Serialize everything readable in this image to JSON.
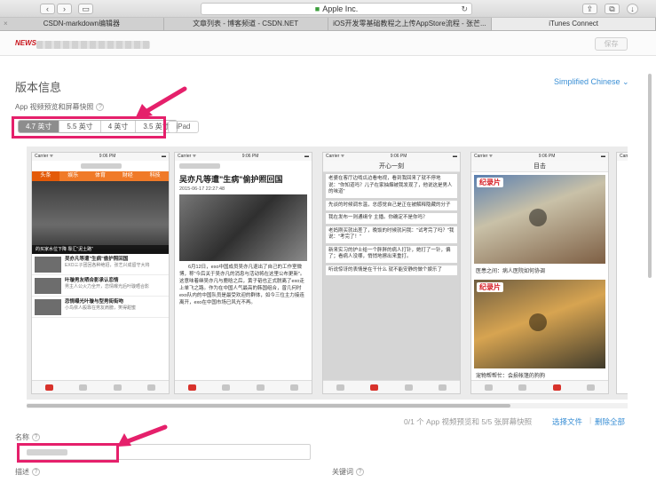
{
  "browser": {
    "address": "Apple Inc.",
    "tabs": [
      {
        "label": "CSDN-markdown编辑器",
        "active": false
      },
      {
        "label": "文章列表 - 博客频道 - CSDN.NET",
        "active": false
      },
      {
        "label": "iOS开发零基础教程之上传AppStore流程 - 张芒...",
        "active": false
      },
      {
        "label": "iTunes Connect",
        "active": true
      }
    ]
  },
  "header": {
    "logo_text": "NEWS",
    "save_label": "保存"
  },
  "main": {
    "section_title": "版本信息",
    "language": "Simplified Chinese ⌄",
    "media_label": "App 视频预览和屏幕快照",
    "help_mark": "?",
    "device_tabs": [
      {
        "label": "4.7 英寸",
        "active": true
      },
      {
        "label": "5.5 英寸",
        "active": false
      },
      {
        "label": "4 英寸",
        "active": false
      },
      {
        "label": "3.5 英寸",
        "active": false
      }
    ],
    "ipad_label": "iPad",
    "screenshot_meta": "0/1 个 App 视频预览和 5/5 张屏幕快照",
    "choose_file": "选择文件",
    "delete_all": "删除全部",
    "separator": "|",
    "name_label": "名称",
    "desc_label": "描述",
    "keywords_label": "关键词"
  },
  "screens": {
    "carrier": "Carrier ᯤ",
    "time": "9:06 PM",
    "s1": {
      "nav": [
        "头条",
        "娱乐",
        "体育",
        "财经",
        "科技"
      ],
      "hero_caption": "的买家水位下降 靠汇\"泥土路\"",
      "hero_headline": "吴亦凡等遭\"生病\"偷护照回国",
      "items": [
        {
          "title": "吴亦凡等遭\"生病\"偷护照回国",
          "sub": "EXO三子团回各种绝招，张艺兴成留守大将"
        },
        {
          "title": "叶璇男友晒合影承认恋情",
          "sub": "男主人公火力全开，恋情曝光后叶璇晒合影"
        },
        {
          "title": "恋情曝光叶璇与型男街街吻",
          "sub": "小鸟依人般靠在男友肩膀，笑得甜蜜"
        }
      ]
    },
    "s2": {
      "title": "吴亦凡等遭\"生病\"偷护照回国",
      "date": "2015-06-17 22:27:48",
      "body": "6月12日，exo中国成员吴亦凡退出了自己的工作室微博，称\"今后关于吴亦凡的消息与活动将在这里公布更新\"。这意味着继吴亦凡与鹿晗之后，黄子韬也正式脱离了exo走上单飞之路。作为在中国人气最高的韩国组合，曾几何时exo队内的中国队员是最受欢迎的群体，如今三位主力接连离开，exo在中国市场已风光不再。"
    },
    "s3": {
      "title": "开心一刻",
      "cards": [
        "老婆在客厅边啃瓜边看电视，看到我回来了就不停地说：\"你知道吗？儿子在家抽烟被我发现了，他说这是男人的味道\"",
        "先谈的时候调东温，总感觉自己是正在被解释隐藏的分子",
        "我在发布一则通缉令 主播。你确定不是你吗？",
        "老妈刚买就出差了，晚饭的时候就问我：\"试考完了吗？\"我说：\"考完了！\"",
        "新来实习的护士给一个胖胖的病人打针，她打了一针，偏了；看病人没哪，悄悄地擦出来重打。",
        "听说惊讶的表情是在干什么 就不能安静的做个娱乐了"
      ]
    },
    "s4": {
      "title": "目击",
      "badge": "纪录片",
      "cap1": "医患之间：病人医院如何协调",
      "cap2": "宠物帮帮忙：会损帐篷的狗狗"
    }
  }
}
